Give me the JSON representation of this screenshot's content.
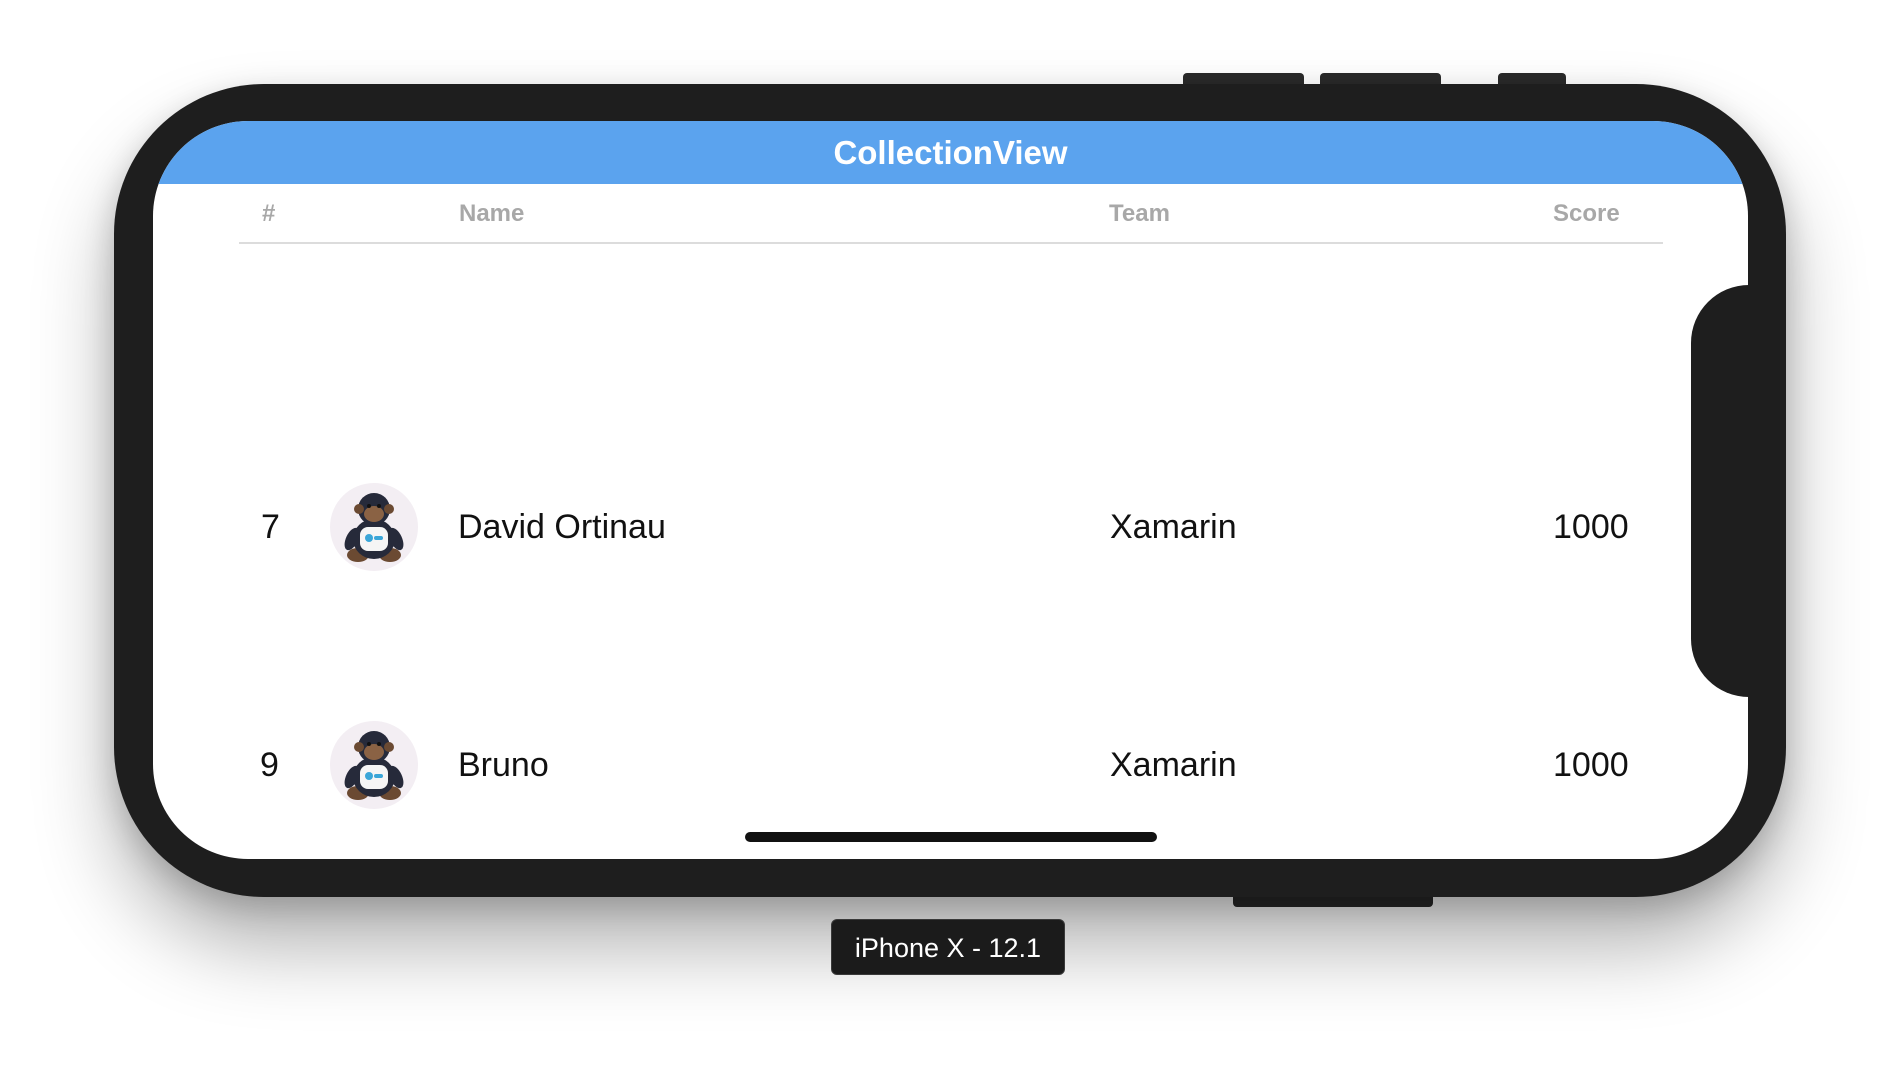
{
  "app": {
    "title": "CollectionView",
    "accent_color": "#5ba3ee"
  },
  "columns": {
    "rank": "#",
    "name": "Name",
    "team": "Team",
    "score": "Score"
  },
  "rows": [
    {
      "rank": "7",
      "avatar_icon": "monkey-avatar-icon",
      "name": "David Ortinau",
      "team": "Xamarin",
      "score": "1000"
    },
    {
      "rank": "9",
      "avatar_icon": "monkey-avatar-icon",
      "name": "Bruno",
      "team": "Xamarin",
      "score": "1000"
    }
  ],
  "simulator": {
    "device_label": "iPhone X - 12.1"
  }
}
